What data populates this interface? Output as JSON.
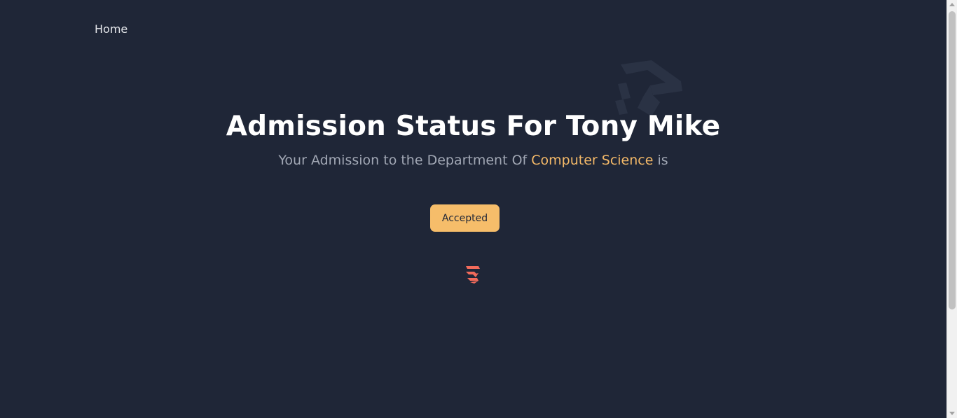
{
  "nav": {
    "home_label": "Home"
  },
  "hero": {
    "title": "Admission Status For Tony Mike",
    "subtitle_prefix": "Your Admission to the Department Of ",
    "department": "Computer Science",
    "subtitle_suffix": " is"
  },
  "status": {
    "label": "Accepted"
  },
  "icons": {
    "watermark": "graduation-cap-icon",
    "logo": "brand-logo-icon"
  },
  "colors": {
    "background": "#1f2637",
    "accent": "#f4b968",
    "badge": "#f6bd6a",
    "logo": "#f26b5b"
  }
}
